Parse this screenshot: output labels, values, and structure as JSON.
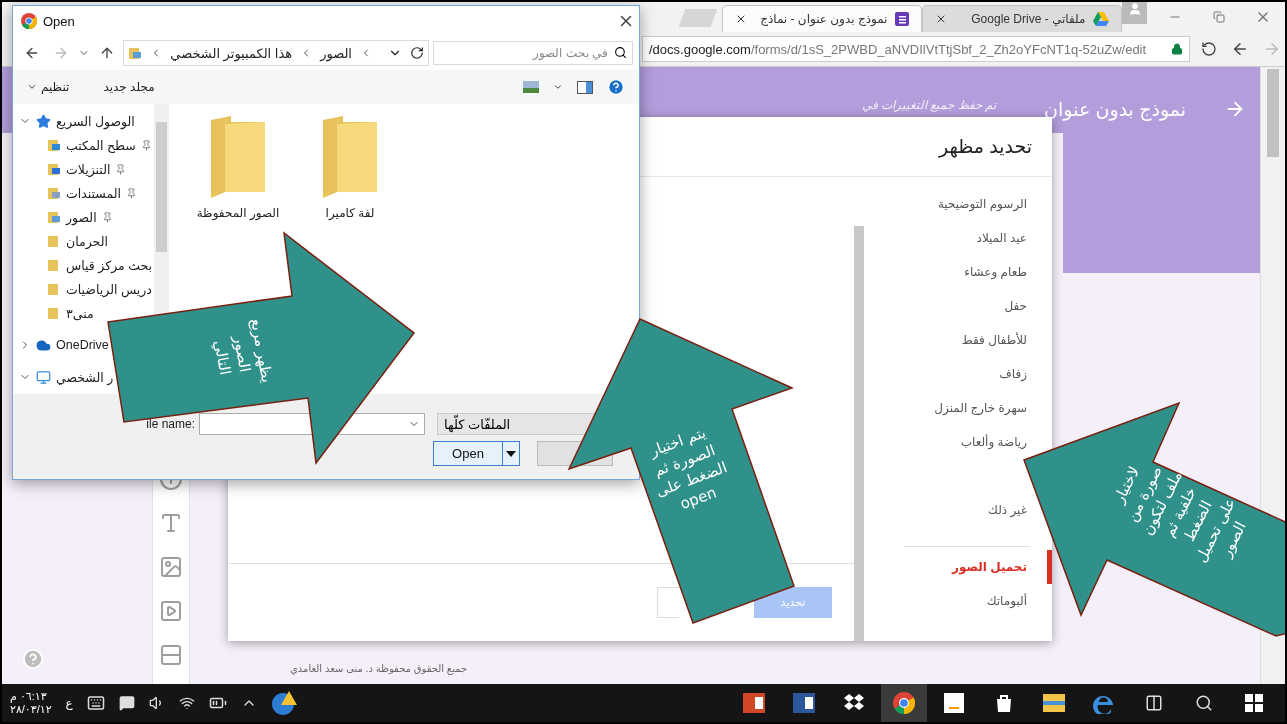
{
  "browser": {
    "tabs": [
      {
        "title": "ملفاتي - Google Drive",
        "kind": "drive",
        "selected": false
      },
      {
        "title": "نموذج بدون عنوان - نماذج",
        "kind": "form",
        "selected": true
      }
    ],
    "url": {
      "host": "/docs.google.com",
      "path": "/forms/d/1sS_2PWBD_aNVDIlVtTtjSbf_2_Zh2oYFcNT1q-52uZw/edit"
    },
    "form": {
      "title": "نموذج بدون عنوان",
      "save_status": "تم حفظ جميع التغييرات في",
      "footer": "جميع الحقوق محفوظة د. منى سعد الغامدي"
    }
  },
  "theme_dialog": {
    "title": "تحديد مظهر",
    "categories": [
      {
        "label": "الرسوم التوضيحية",
        "selected": false
      },
      {
        "label": "عيد الميلاد",
        "selected": false
      },
      {
        "label": "طعام وعشاء",
        "selected": false
      },
      {
        "label": "حفل",
        "selected": false
      },
      {
        "label": "للأطفال فقط",
        "selected": false
      },
      {
        "label": "زفاف",
        "selected": false
      },
      {
        "label": "سهرة خارج المنزل",
        "selected": false
      },
      {
        "label": "رياضة وألعاب",
        "selected": false
      }
    ],
    "more": [
      {
        "label": "غير ذلك",
        "selected": false
      }
    ],
    "sources": [
      {
        "label": "تحميل الصور",
        "selected": true
      },
      {
        "label": "ألبوماتك",
        "selected": false
      }
    ],
    "select_button": {
      "label": "تحديد",
      "disabled": true
    }
  },
  "open_dialog": {
    "title": "Open",
    "path": [
      "الصور",
      "هذا الكمبيوتر الشخصي"
    ],
    "search_placeholder": "في بحث الصور",
    "organize": "تنظيم",
    "new_folder": "مجلد جديد",
    "nav": [
      {
        "label": "الوصول السريع",
        "kind": "star",
        "expanded": true,
        "children": [
          {
            "label": "سطح المكتب",
            "kind": "desktop",
            "pinned": true
          },
          {
            "label": "التنزيلات",
            "kind": "download",
            "pinned": true
          },
          {
            "label": "المستندات",
            "kind": "document",
            "pinned": true
          },
          {
            "label": "الصور",
            "kind": "pictures",
            "pinned": true
          },
          {
            "label": "الحرمان",
            "kind": "folder",
            "pinned": false
          },
          {
            "label": "بحث مركز قياس",
            "kind": "folder",
            "pinned": false
          },
          {
            "label": "دريس الرياضيات",
            "kind": "folder",
            "pinned": false
          },
          {
            "label": "منى٣",
            "kind": "folder",
            "pinned": false
          }
        ]
      },
      {
        "label": "OneDrive",
        "kind": "cloud",
        "expanded": false
      },
      {
        "label": "ر الشخصي",
        "kind": "pc",
        "expanded": true
      }
    ],
    "folders": [
      "لفة كاميرا",
      "الصور المحفوظة"
    ],
    "file_name_label": "ile name:",
    "file_type": "الملفّات كلّها",
    "open_button": "Open"
  },
  "callouts": [
    {
      "text": "يظهر مربع الصور التالي"
    },
    {
      "text": "يتم اختيار الصورة ثم الضغط على open"
    },
    {
      "text": "لاختيار صورة من ملف لتكون خلفية ثم الضغط على تحميل الصور"
    }
  ],
  "taskbar": {
    "time": "٠٦:١٣ م",
    "date": "٢٨/٠٣/١٢",
    "language": "ع"
  }
}
